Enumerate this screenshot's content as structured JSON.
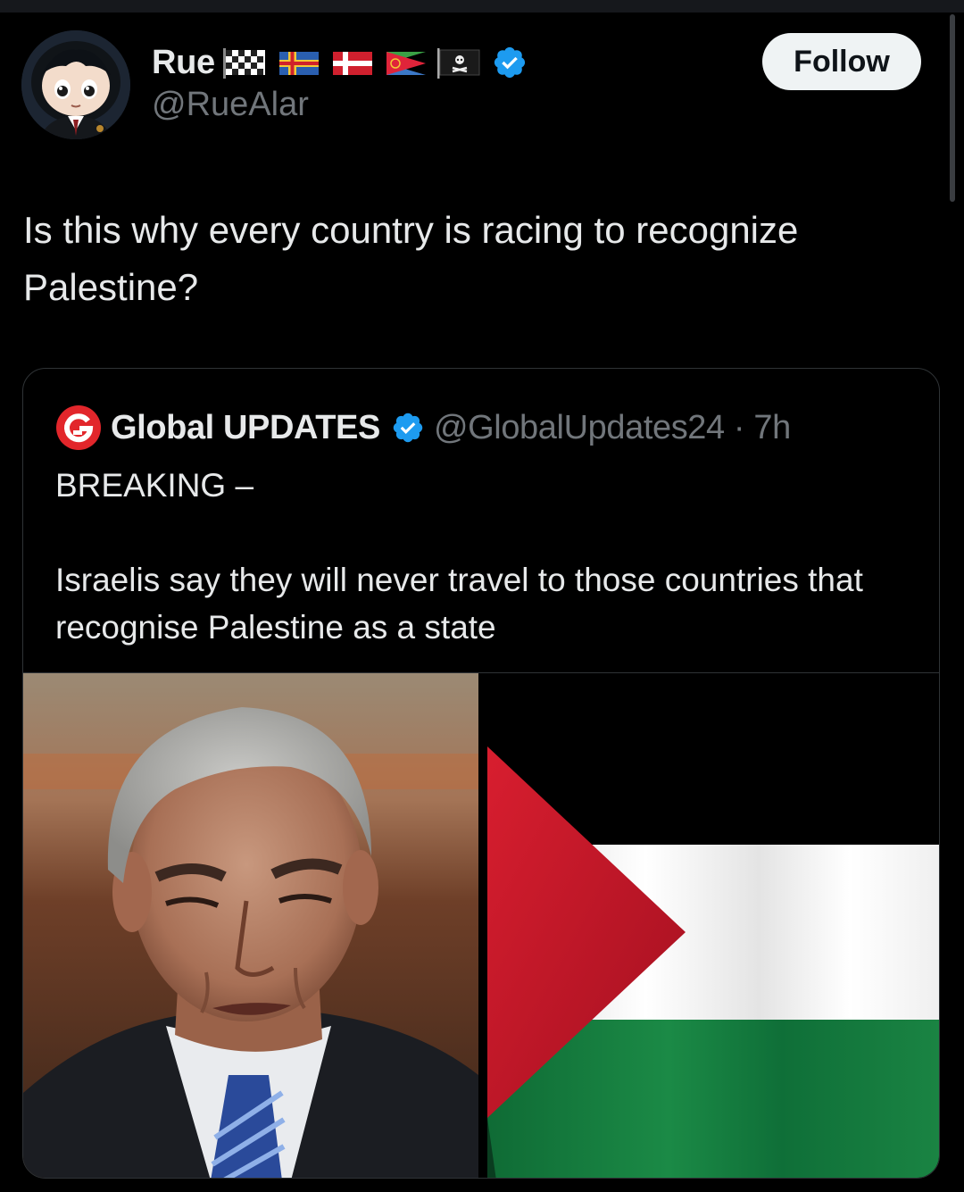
{
  "tweet": {
    "author": {
      "display_name": "Rue",
      "handle": "@RueAlar",
      "verified": true,
      "flag_icons": [
        "checkered-flag-icon",
        "aland-flag-icon",
        "denmark-flag-icon",
        "eritrea-flag-icon",
        "pirate-flag-icon"
      ]
    },
    "follow_label": "Follow",
    "text": "Is this why every country is racing to recognize Palestine?"
  },
  "quoted_tweet": {
    "display_name": "Global UPDATES",
    "handle_time": "@GlobalUpdates24 · 7h",
    "verified": true,
    "text": "BREAKING –\n\nIsraelis say they will never travel to those countries that recognise Palestine as a state",
    "media": [
      {
        "type": "photo",
        "subject": "man-in-suit-photo"
      },
      {
        "type": "photo",
        "subject": "palestinian-flag-photo"
      }
    ]
  },
  "colors": {
    "background": "#000000",
    "text_primary": "#e7e9ea",
    "text_secondary": "#71767b",
    "verified_blue": "#1d9bf0",
    "border": "#2f3336",
    "follow_bg": "#eff3f4"
  }
}
